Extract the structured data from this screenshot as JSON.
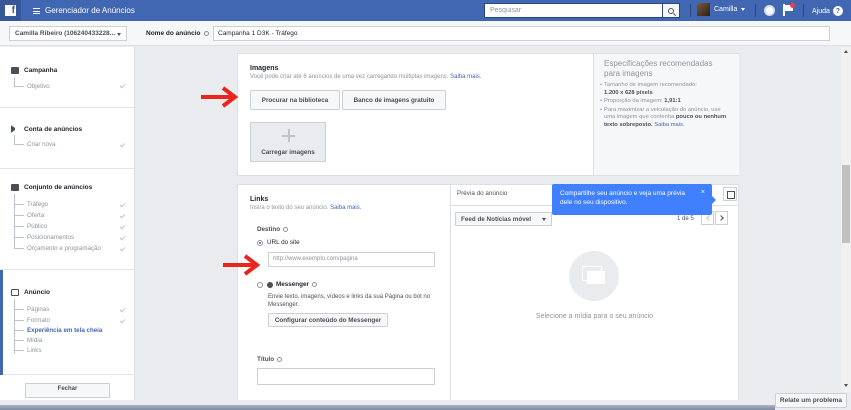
{
  "topbar": {
    "logo": "f",
    "app_title": "Gerenciador de Anúncios",
    "search_placeholder": "Pesquisar",
    "user_name": "Camilla",
    "help_label": "Ajuda",
    "help_icon": "?"
  },
  "subbar": {
    "account": "Camilla Ribeiro (106240433228...",
    "ad_name_label": "Nome do anúncio",
    "ad_name_value": "Campanha 1 D3K - Tráfego"
  },
  "leftnav": {
    "sections": [
      {
        "title": "Campanha",
        "items": [
          "Objetivo"
        ]
      },
      {
        "title": "Conta de anúncios",
        "items": [
          "Criar nova"
        ]
      },
      {
        "title": "Conjunto de anúncios",
        "items": [
          "Tráfego",
          "Oferta",
          "Público",
          "Posicionamentos",
          "Orçamento e programação"
        ]
      },
      {
        "title": "Anúncio",
        "items": [
          "Páginas",
          "Formato",
          "Experiência em tela cheia",
          "Mídia",
          "Links"
        ]
      }
    ],
    "close_label": "Fechar"
  },
  "images": {
    "title": "Imagens",
    "desc": "Você pode criar até 6 anúncios de uma vez carregando múltiplas imagens.",
    "learn_more": "Saiba mais.",
    "browse_library": "Procurar na biblioteca",
    "free_images": "Banco de imagens gratuito",
    "upload": "Carregar imagens"
  },
  "specs": {
    "title": "Especificações recomendadas para imagens",
    "items": [
      {
        "text": "Tamanho de imagem recomendado:",
        "bold": "1.200 x 628 pixels"
      },
      {
        "text": "Proporção da imagem:",
        "bold": "1,91:1"
      },
      {
        "text": "Para maximizar a veiculação do anúncio, use uma imagem que contenha",
        "bold": "pouco ou nenhum texto sobreposto.",
        "link": "Saiba mais."
      }
    ]
  },
  "links": {
    "title": "Links",
    "desc": "Insira o texto do seu anúncio.",
    "learn_more": "Saiba mais.",
    "destination_label": "Destino",
    "url_option": "URL do site",
    "url_placeholder": "http://www.exemplo.com/pagina",
    "messenger_option": "Messenger",
    "messenger_desc": "Envie texto, imagens, vídeos e links da sua Página ou bot no Messenger.",
    "messenger_button": "Configurar conteúdo do Messenger",
    "title_label": "Título"
  },
  "preview": {
    "title": "Prévia do anúncio",
    "feed_select": "Feed de Notícias móvel",
    "pager": "1 de 5",
    "message": "Selecione a mídia para o seu anúncio"
  },
  "tooltip": {
    "text": "Compartilhe seu anúncio e veja uma prévia dele no seu dispositivo.",
    "close": "×"
  },
  "footer": {
    "report_problem": "Relate um problema"
  },
  "colors": {
    "brand": "#4267b2",
    "tooltip": "#4080ff",
    "arrow": "#e8261c"
  }
}
